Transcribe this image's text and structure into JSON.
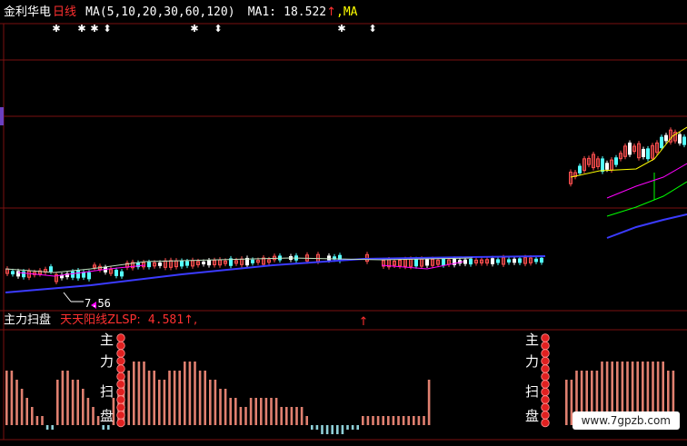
{
  "upper_header": {
    "stock_name": "金利华电",
    "period": "日线",
    "ma_params": "MA(5,10,20,30,60,120)",
    "ma1_label": "MA1:",
    "ma1_value": "18.522",
    "ma1_arrow": "↑",
    "ma_tail": ",MA"
  },
  "lower_header": {
    "indicator_name": "主力扫盘",
    "line_label": "天天阳线ZLSP:",
    "line_value": "4.581",
    "line_arrow": "↑",
    "line_tail": ","
  },
  "annotation": {
    "low_price_label": "7.56"
  },
  "signal_labels": {
    "left": [
      "主",
      "力",
      "扫",
      "盘"
    ],
    "right": [
      "主",
      "力",
      "扫",
      "盘"
    ]
  },
  "watermark": "www.7gpzb.com",
  "colors": {
    "background": "#000000",
    "grid": "#7a1010",
    "up": "#ff5050",
    "down": "#54ffff",
    "white": "#ffffff",
    "yellow": "#ffff00",
    "magenta": "#ff00ff",
    "green": "#00ff00",
    "blue": "#3b3bff",
    "histo_pos": "#e08070",
    "histo_neg": "#8fd0d8",
    "signal_dot": "#e02020"
  },
  "chart_data": [
    {
      "type": "line",
      "title": "",
      "note": "Candlestick price chart with moving averages; price flat near recent low then jumps after gap",
      "series": [
        {
          "name": "MA1",
          "last_value": 18.522
        }
      ],
      "low_marker": 7.56
    },
    {
      "type": "bar",
      "title": "",
      "series": [
        {
          "name": "ZLSP",
          "last_value": 4.581
        }
      ],
      "values": [
        6,
        6,
        5,
        4,
        3,
        2,
        1,
        1,
        -1,
        -1,
        5,
        6,
        6,
        5,
        5,
        4,
        3,
        2,
        1,
        -1,
        -1,
        3,
        4,
        5,
        6,
        7,
        7,
        7,
        6,
        6,
        5,
        5,
        6,
        6,
        6,
        7,
        7,
        7,
        6,
        6,
        5,
        5,
        4,
        4,
        3,
        3,
        2,
        2,
        3,
        3,
        3,
        3,
        3,
        3,
        2,
        2,
        2,
        2,
        2,
        1,
        -1,
        -1,
        -2,
        -2,
        -2,
        -2,
        -2,
        -1,
        -1,
        -1,
        1,
        1,
        1,
        1,
        1,
        1,
        1,
        1,
        1,
        1,
        1,
        1,
        1,
        5,
        5,
        5,
        6,
        6,
        6,
        6,
        6,
        7,
        7,
        7,
        7,
        7,
        7,
        7,
        7,
        7,
        7,
        7,
        7,
        7,
        6,
        6
      ]
    }
  ]
}
